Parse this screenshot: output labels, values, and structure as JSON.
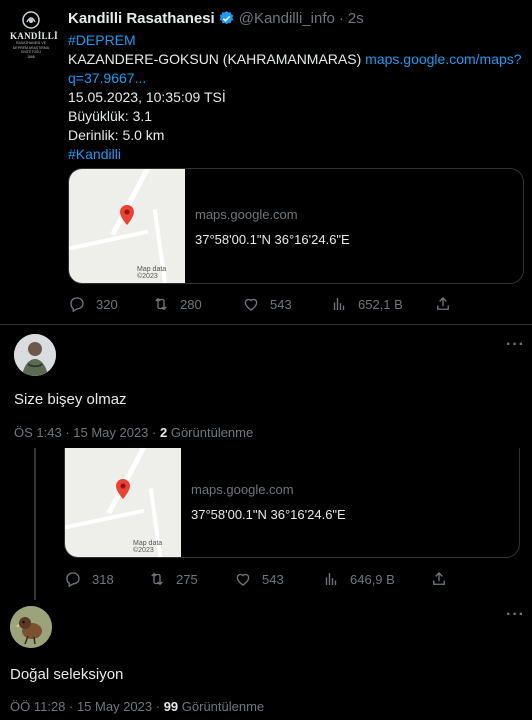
{
  "tweet": {
    "author_name": "Kandilli Rasathanesi",
    "handle": "@Kandilli_info",
    "separator": "·",
    "time_ago": "2s",
    "logo_text": "KANDİLLİ",
    "logo_sub1": "RASATHANESİ VE",
    "logo_sub2": "DEPREM ARAŞTIRMA",
    "logo_sub3": "ENSTİTÜSÜ",
    "logo_year": "1868",
    "hashtag_deprem": "#DEPREM",
    "location": "KAZANDERE-GOKSUN (KAHRAMANMARAS)",
    "map_link_1": "maps.google.com/maps?",
    "map_link_2": "q=37.9667...",
    "datetime": "15.05.2023, 10:35:09 TSİ",
    "magnitude": "Büyüklük: 3.1",
    "depth": "Derinlik: 5.0 km",
    "hashtag_kandilli": "#Kandilli",
    "card": {
      "domain": "maps.google.com",
      "coords": "37°58'00.1\"N 36°16'24.6\"E",
      "credit": "Map data ©2023"
    },
    "actions": {
      "replies": "320",
      "retweets": "280",
      "likes": "543",
      "views": "652,1 B"
    }
  },
  "reply1": {
    "text": "Size bişey olmaz",
    "time": "ÖS 1:43 · 15 May 2023 ·",
    "views_count": "2",
    "views_label": "Görüntülenme",
    "card": {
      "domain": "maps.google.com",
      "coords": "37°58'00.1\"N 36°16'24.6\"E",
      "credit": "Map data ©2023"
    },
    "actions": {
      "replies": "318",
      "retweets": "275",
      "likes": "543",
      "views": "646,9 B"
    }
  },
  "reply2": {
    "text": "Doğal seleksiyon",
    "time": "ÖÖ 11:28 · 15 May 2023 ·",
    "views_count": "99",
    "views_label": "Görüntülenme"
  },
  "more_label": "···"
}
